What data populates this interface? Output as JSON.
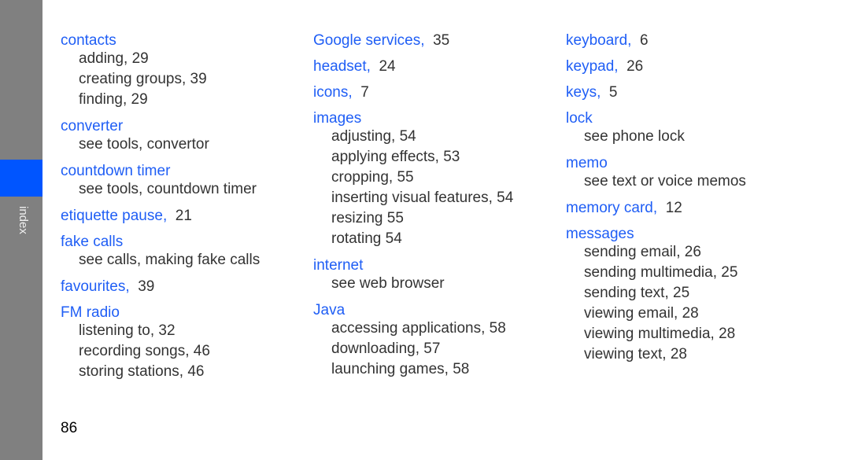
{
  "sidebar": {
    "label": "index",
    "accent": "#0055ff",
    "background": "#808080"
  },
  "columns": [
    [
      {
        "term": "contacts",
        "page": "",
        "subs": [
          "adding,  29",
          "creating groups,  39",
          "finding,  29"
        ]
      },
      {
        "term": "converter",
        "page": "",
        "subs": [
          "see tools, convertor"
        ]
      },
      {
        "term": "countdown timer",
        "page": "",
        "subs": [
          "see tools, countdown timer"
        ]
      },
      {
        "term": "etiquette pause,",
        "page": "21",
        "subs": []
      },
      {
        "term": "fake calls",
        "page": "",
        "subs": [
          "see calls, making fake calls"
        ]
      },
      {
        "term": "favourites,",
        "page": "39",
        "subs": []
      },
      {
        "term": "FM radio",
        "page": "",
        "subs": [
          "listening to,  32",
          "recording songs,  46",
          "storing stations,  46"
        ]
      }
    ],
    [
      {
        "term": "Google services,",
        "page": "35",
        "subs": []
      },
      {
        "term": "headset,",
        "page": "24",
        "subs": []
      },
      {
        "term": "icons,",
        "page": "7",
        "subs": []
      },
      {
        "term": "images",
        "page": "",
        "subs": [
          "adjusting,  54",
          "applying effects,  53",
          "cropping,  55",
          "inserting visual features,  54",
          "resizing  55",
          "rotating  54"
        ]
      },
      {
        "term": "internet",
        "page": "",
        "subs": [
          "see web browser"
        ]
      },
      {
        "term": "Java",
        "page": "",
        "subs": [
          "accessing applications,  58",
          "downloading,  57",
          "launching games,  58"
        ]
      }
    ],
    [
      {
        "term": "keyboard,",
        "page": "6",
        "subs": []
      },
      {
        "term": "keypad,",
        "page": "26",
        "subs": []
      },
      {
        "term": "keys,",
        "page": "5",
        "subs": []
      },
      {
        "term": "lock",
        "page": "",
        "subs": [
          "see phone lock"
        ]
      },
      {
        "term": "memo",
        "page": "",
        "subs": [
          "see text or voice memos"
        ]
      },
      {
        "term": "memory card,",
        "page": "12",
        "subs": []
      },
      {
        "term": "messages",
        "page": "",
        "subs": [
          "sending email,  26",
          "sending multimedia,  25",
          "sending text,  25",
          "viewing email,  28",
          "viewing multimedia,  28",
          "viewing text,  28"
        ]
      }
    ]
  ],
  "page_number": "86"
}
